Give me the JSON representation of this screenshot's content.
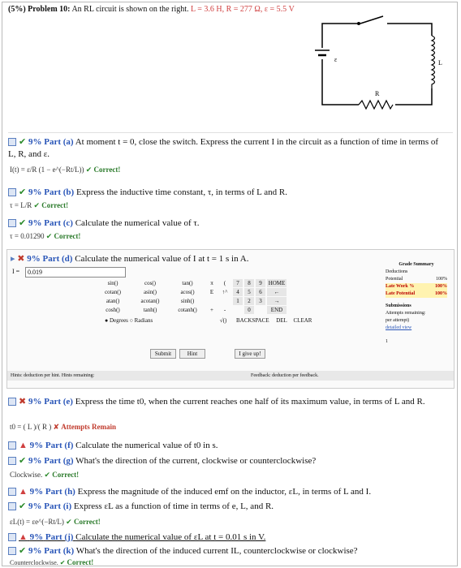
{
  "header": {
    "points": "(5%)",
    "problem": "Problem 10:",
    "statement": "An RL circuit is shown on the right.",
    "given": "L = 3.6 H, R = 277 Ω, ε = 5.5 V"
  },
  "circuit": {
    "label_L": "L",
    "label_R": "R",
    "label_E": "ε"
  },
  "parts": [
    {
      "id": "a",
      "pct": "9%",
      "label": "Part (a)",
      "text": "At moment t = 0, close the switch. Express the current I in the circuit as a function of time in terms of L, R, and ε.",
      "answer": "I(t) = ε/R (1 − e^(−Rt/L))",
      "status": "Correct!"
    },
    {
      "id": "b",
      "pct": "9%",
      "label": "Part (b)",
      "text": "Express the inductive time constant, τ, in terms of L and R.",
      "answer": "τ = L/R",
      "status": "Correct!"
    },
    {
      "id": "c",
      "pct": "9%",
      "label": "Part (c)",
      "text": "Calculate the numerical value of τ.",
      "answer": "τ = 0.01290",
      "status": "Correct!"
    },
    {
      "id": "d",
      "pct": "9%",
      "label": "Part (d)",
      "text": "Calculate the numerical value of I at t = 1 s in A."
    },
    {
      "id": "e",
      "pct": "9%",
      "label": "Part (e)",
      "text": "Express the time t0, when the current reaches one half of its maximum value, in terms of L and R.",
      "answer": "t0 = ( L )/( R )",
      "status": "Attempts Remain"
    },
    {
      "id": "f",
      "pct": "9%",
      "label": "Part (f)",
      "text": "Calculate the numerical value of t0 in s."
    },
    {
      "id": "g",
      "pct": "9%",
      "label": "Part (g)",
      "text": "What's the direction of the current, clockwise or counterclockwise?",
      "answer": "Clockwise.",
      "status": "Correct!"
    },
    {
      "id": "h",
      "pct": "9%",
      "label": "Part (h)",
      "text": "Express the magnitude of the induced emf on the inductor, εL, in terms of L and I."
    },
    {
      "id": "i",
      "pct": "9%",
      "label": "Part (i)",
      "text": "Express εL as a function of time in terms of e, L, and R.",
      "answer": "εL(t) = εe^(−Rt/L)",
      "status": "Correct!"
    },
    {
      "id": "j",
      "pct": "9%",
      "label": "Part (j)",
      "text": "Calculate the numerical value of εL at t = 0.01 s in V."
    },
    {
      "id": "k",
      "pct": "9%",
      "label": "Part (k)",
      "text": "What's the direction of the induced current IL, counterclockwise or clockwise?",
      "answer": "Counterclockwise.",
      "status": "Correct!"
    }
  ],
  "partd": {
    "input_label": "I =",
    "input_value": "0.019",
    "funcs": [
      [
        "sin()",
        "cos()",
        "tan()"
      ],
      [
        "cotan()",
        "asin()",
        "acos()"
      ],
      [
        "atan()",
        "acotan()",
        "sinh()"
      ],
      [
        "cosh()",
        "tanh()",
        "cotanh()"
      ]
    ],
    "consts": [
      [
        "π",
        "("
      ],
      [
        "E",
        "↑^"
      ],
      [
        "",
        ""
      ],
      [
        "+",
        "-"
      ]
    ],
    "keypad": [
      [
        "7",
        "8",
        "9",
        "HOME"
      ],
      [
        "4",
        "5",
        "6",
        "←"
      ],
      [
        "1",
        "2",
        "3",
        "→"
      ],
      [
        "",
        "0",
        "",
        "END"
      ]
    ],
    "bottom": [
      "√()",
      "BACKSPACE",
      "DEL",
      "CLEAR"
    ],
    "degrees": "Degrees",
    "radians": "Radians",
    "submit": "Submit",
    "hint": "Hint",
    "giveup": "I give up!",
    "hints_text": "Hints:  deduction per hint. Hints remaining:",
    "feedback_text": "Feedback:  deduction per feedback.",
    "grade": {
      "title": "Grade Summary",
      "deductions": "Deductions",
      "potential": "Potential",
      "potential_val": "100%",
      "late_work": "Late Work %",
      "late_work_val": "100%",
      "late_potential": "Late Potential",
      "late_potential_val": "100%",
      "submissions": "Submissions",
      "attempts": "Attempts remaining:",
      "per_attempt": "per attempt)",
      "detailed": "detailed view",
      "row_num": "1"
    }
  }
}
